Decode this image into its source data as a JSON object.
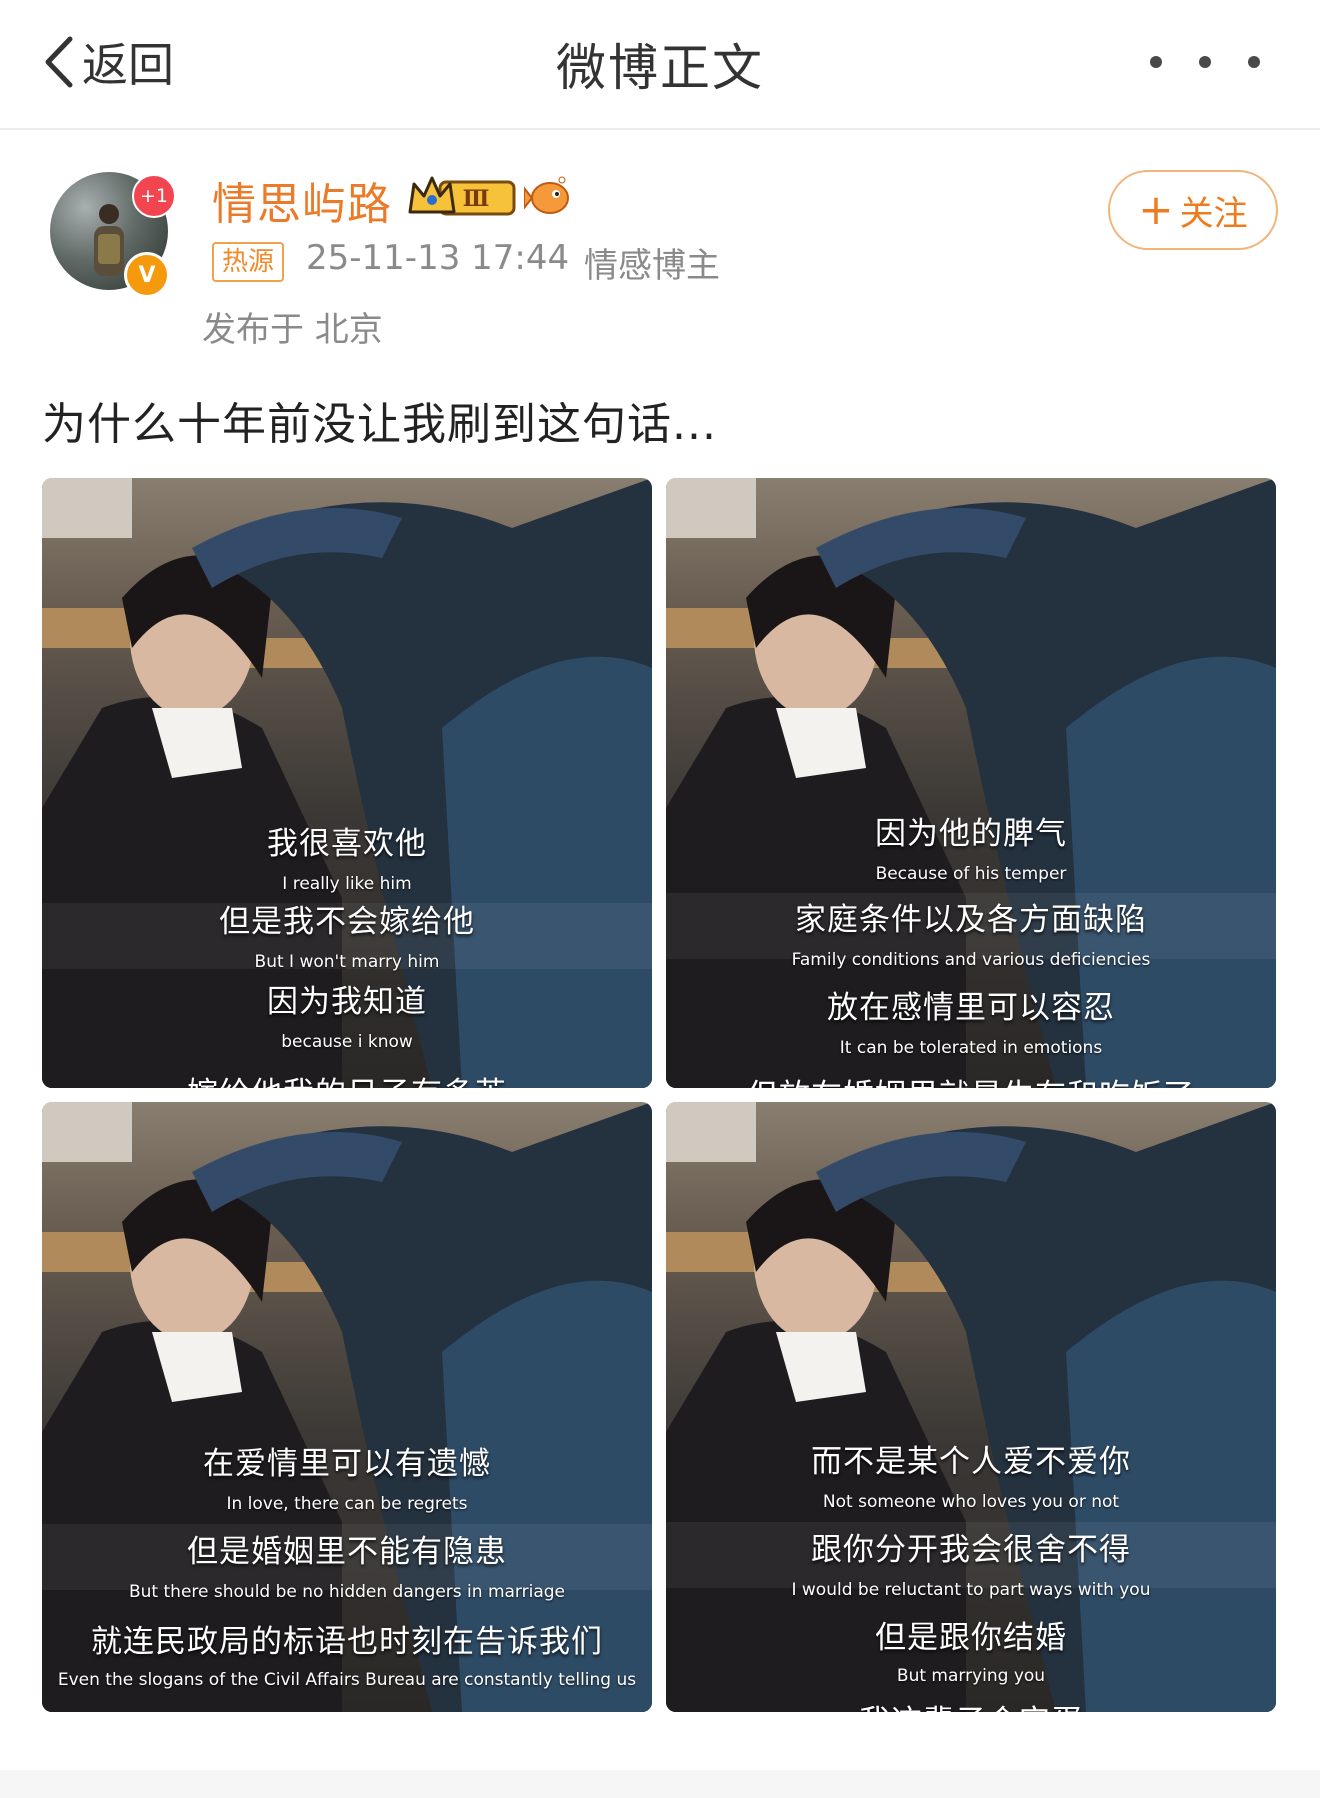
{
  "header": {
    "back_label": "返回",
    "title": "微博正文"
  },
  "author": {
    "name": "情思屿路",
    "avatar_badge": "+1",
    "verified_mark": "V",
    "level_badge": "Ⅲ",
    "tag": "热源",
    "time": "25-11-13 17:44",
    "role": "情感博主",
    "location": "发布于 北京",
    "follow_label": "关注",
    "follow_plus": "+"
  },
  "post": {
    "text": "为什么十年前没让我刷到这句话..."
  },
  "images": [
    {
      "captions": [
        {
          "cn": "我很喜欢他",
          "en": "I really like him"
        },
        {
          "cn": "但是我不会嫁给他",
          "en": "But I won't marry him"
        },
        {
          "cn": "因为我知道",
          "en": "because i know"
        },
        {
          "cn": "嫁给他我的日子有多苦",
          "en": ""
        }
      ]
    },
    {
      "captions": [
        {
          "cn": "因为他的脾气",
          "en": "Because of his temper"
        },
        {
          "cn": "家庭条件以及各方面缺陷",
          "en": "Family conditions and various deficiencies"
        },
        {
          "cn": "放在感情里可以容忍",
          "en": "It can be tolerated in emotions"
        },
        {
          "cn": "但放在婚姻里就是生存和吃饭了",
          "en": ""
        }
      ]
    },
    {
      "captions": [
        {
          "cn": "在爱情里可以有遗憾",
          "en": "In love, there can be regrets"
        },
        {
          "cn": "但是婚姻里不能有隐患",
          "en": "But there should be no hidden dangers in marriage"
        },
        {
          "cn": "就连民政局的标语也时刻在告诉我们",
          "en": "Even the slogans of the Civil Affairs Bureau are constantly telling us"
        }
      ]
    },
    {
      "captions": [
        {
          "cn": "而不是某个人爱不爱你",
          "en": "Not someone who loves you or not"
        },
        {
          "cn": "跟你分开我会很舍不得",
          "en": "I would be reluctant to part ways with you"
        },
        {
          "cn": "但是跟你结婚",
          "en": "But marrying you"
        },
        {
          "cn": "我这辈子会完蛋",
          "en": ""
        }
      ]
    }
  ],
  "colors": {
    "username": "#eb7b29",
    "meta": "#8a8a8a",
    "follow": "#ee7b1d"
  }
}
